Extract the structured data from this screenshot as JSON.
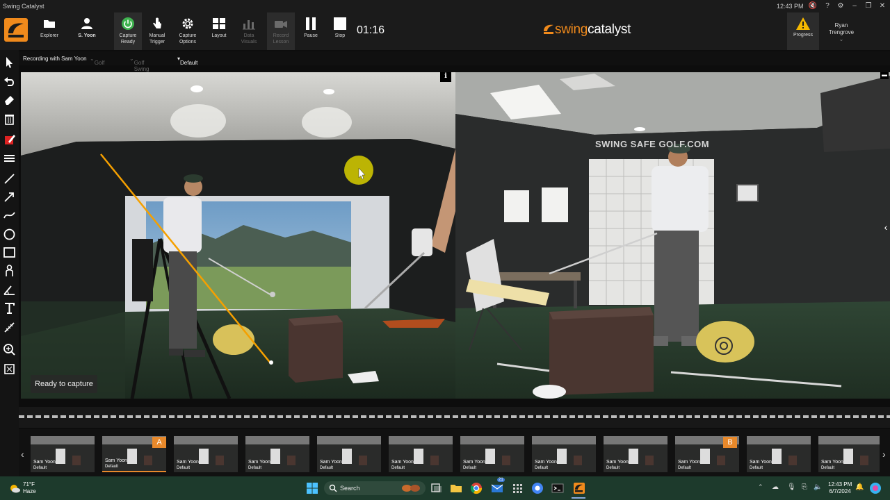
{
  "window": {
    "title": "Swing Catalyst",
    "clock": "12:43 PM"
  },
  "toolbar": {
    "explorer": "Explorer",
    "user_short": "S. Yoon",
    "capture_ready_1": "Capture",
    "capture_ready_2": "Ready",
    "manual_trigger_1": "Manual",
    "manual_trigger_2": "Trigger",
    "capture_options_1": "Capture",
    "capture_options_2": "Options",
    "layout": "Layout",
    "data_visuals_1": "Data",
    "data_visuals_2": "Visuals",
    "record_lesson_1": "Record",
    "record_lesson_2": "Lesson",
    "pause": "Pause",
    "stop": "Stop",
    "timer": "01:16",
    "brand_1": "swing",
    "brand_2": "catalyst",
    "progress": "Progress",
    "user_first": "Ryan",
    "user_last": "Trengrove"
  },
  "context_bar": {
    "recording": "Recording with Sam Yoon",
    "sport": "Golf",
    "activity": "Golf Swing",
    "preset": "Default"
  },
  "video": {
    "status": "Ready to capture",
    "wall_sign": "SWING SAFE GOLF.COM"
  },
  "thumbnails": [
    {
      "name": "Sam Yoon",
      "sub": "Default"
    },
    {
      "name": "Sam Yoon",
      "sub": "Default"
    },
    {
      "name": "Sam Yoon",
      "sub": "Default"
    },
    {
      "name": "Sam Yoon",
      "sub": "Default"
    },
    {
      "name": "Sam Yoon",
      "sub": "Default"
    },
    {
      "name": "Sam Yoon",
      "sub": "Default"
    },
    {
      "name": "Sam Yoon",
      "sub": "Default"
    },
    {
      "name": "Sam Yoon",
      "sub": "Default"
    },
    {
      "name": "Sam Yoon",
      "sub": "Default"
    },
    {
      "name": "Sam Yoon",
      "sub": "Default"
    },
    {
      "name": "Sam Yoon",
      "sub": "Default"
    },
    {
      "name": "Sam Yoon",
      "sub": "Default"
    }
  ],
  "markers": {
    "a": "A",
    "b": "B"
  },
  "taskbar": {
    "temp": "71°F",
    "condition": "Haze",
    "search_placeholder": "Search",
    "badge": "21",
    "time": "12:43 PM",
    "date": "6/7/2024"
  },
  "colors": {
    "accent": "#f08a1c",
    "capture_green": "#3fb34f",
    "annotation_line": "#f5a000",
    "cursor_highlight": "#d8cf00"
  }
}
